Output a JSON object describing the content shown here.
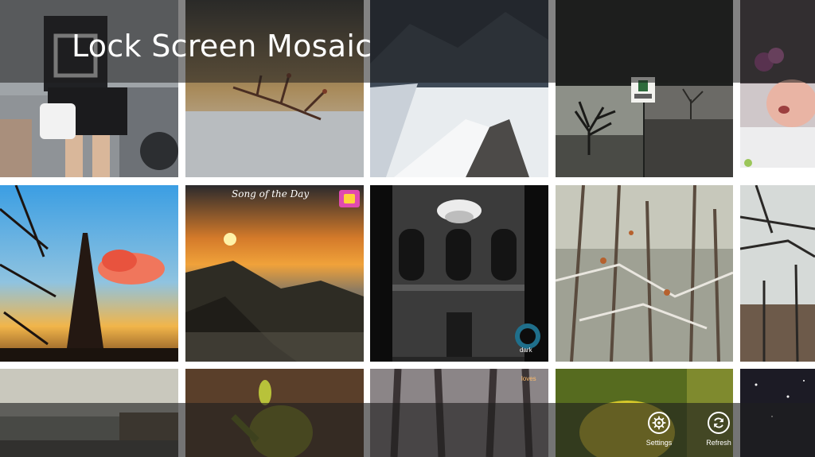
{
  "app": {
    "title": "Lock Screen Mosaic"
  },
  "tiles": {
    "song_of_the_day": "Song of the Day",
    "watermark_dark": "dark",
    "watermark_loves": "loves"
  },
  "appbar": {
    "settings_label": "Settings",
    "settings_icon": "gear-icon",
    "refresh_label": "Refresh",
    "refresh_icon": "refresh-icon"
  }
}
